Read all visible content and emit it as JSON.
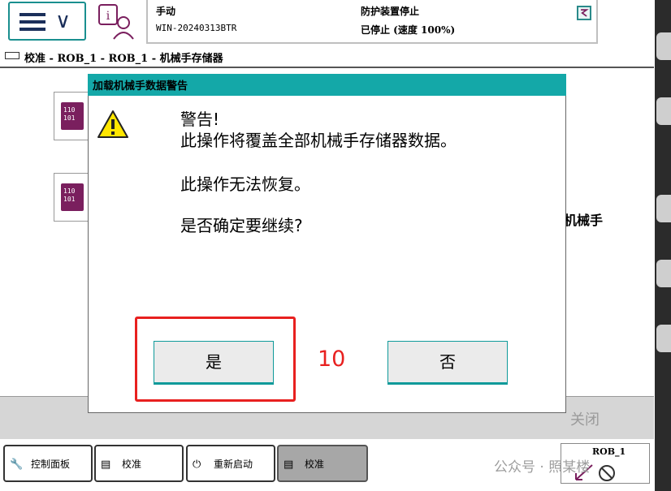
{
  "header": {
    "menu_icon": "hamburger-chevron-icon",
    "info_icon": "info-user-icon",
    "mode": "手动",
    "system_name": "WIN-20240313BTR",
    "guard_status": "防护装置停止",
    "speed_status": "已停止 (速度 100%)"
  },
  "breadcrumb": {
    "text": "校准 - ROB_1 - ROB_1 - 机械手存储器"
  },
  "background": {
    "tile_text": "110\n101",
    "robot_label": "机械手",
    "close_label": "关闭"
  },
  "dialog": {
    "title": "加载机械手数据警告",
    "warning_icon": "warning-icon",
    "line1": "警告!",
    "line2": "此操作将覆盖全部机械手存储器数据。",
    "line3": "此操作无法恢复。",
    "line4": "是否确定要继续?",
    "yes_label": "是",
    "no_label": "否"
  },
  "annotation": {
    "step_number": "10",
    "color": "#e8201f"
  },
  "taskbar": {
    "items": [
      {
        "label": "控制面板",
        "icon": "wrench-icon"
      },
      {
        "label": "校准",
        "icon": "calibration-icon"
      },
      {
        "label": "重新启动",
        "icon": "power-icon"
      },
      {
        "label": "校准",
        "icon": "calibration-icon",
        "active": true
      }
    ],
    "rob_label": "ROB_1"
  },
  "watermark": "公众号 · 照某楼",
  "colors": {
    "accent": "#14a8a8",
    "highlight": "#e8201f",
    "tile": "#7a1f5e"
  }
}
